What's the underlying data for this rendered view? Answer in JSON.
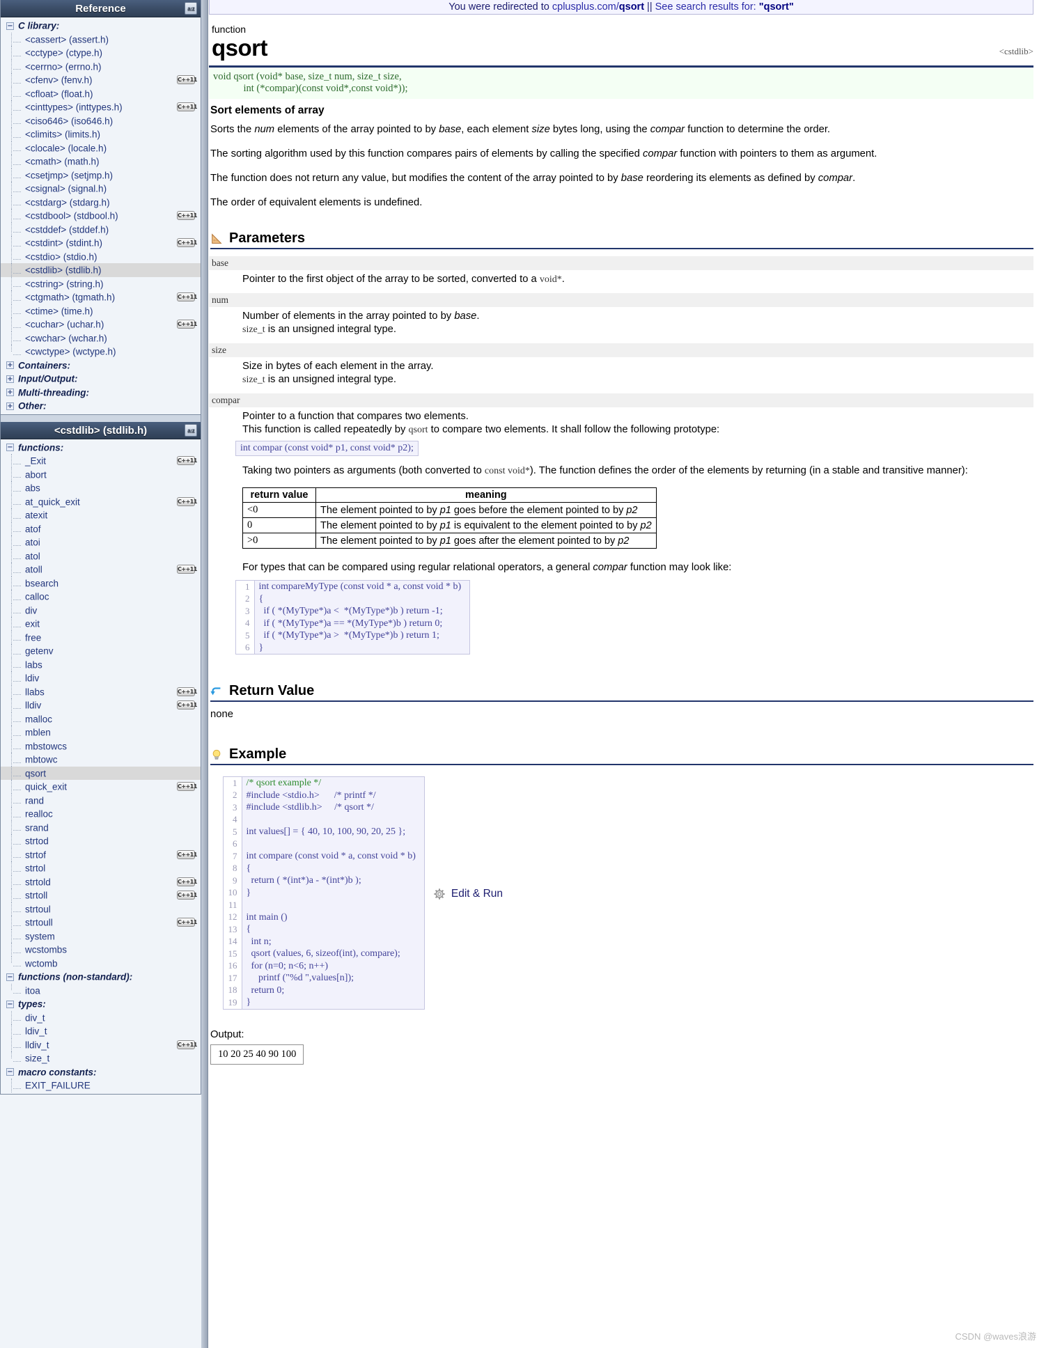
{
  "redirect": {
    "prefix": "You were redirected to ",
    "link": "cplusplus.com/",
    "link_bold": "qsort",
    "separator": " || ",
    "search_text": "See search results for: ",
    "search_term": "\"qsort\""
  },
  "sidebar": {
    "reference_panel": {
      "title": "Reference",
      "az_icon": "a-z-sort-icon",
      "items": [
        {
          "label": "C library:",
          "type": "group",
          "toggle": "−"
        },
        {
          "label": "<cassert> (assert.h)",
          "type": "leaf"
        },
        {
          "label": "<cctype> (ctype.h)",
          "type": "leaf"
        },
        {
          "label": "<cerrno> (errno.h)",
          "type": "leaf"
        },
        {
          "label": "<cfenv> (fenv.h)",
          "type": "leaf",
          "flag": "C++11"
        },
        {
          "label": "<cfloat> (float.h)",
          "type": "leaf"
        },
        {
          "label": "<cinttypes> (inttypes.h)",
          "type": "leaf",
          "flag": "C++11"
        },
        {
          "label": "<ciso646> (iso646.h)",
          "type": "leaf"
        },
        {
          "label": "<climits> (limits.h)",
          "type": "leaf"
        },
        {
          "label": "<clocale> (locale.h)",
          "type": "leaf"
        },
        {
          "label": "<cmath> (math.h)",
          "type": "leaf"
        },
        {
          "label": "<csetjmp> (setjmp.h)",
          "type": "leaf"
        },
        {
          "label": "<csignal> (signal.h)",
          "type": "leaf"
        },
        {
          "label": "<cstdarg> (stdarg.h)",
          "type": "leaf"
        },
        {
          "label": "<cstdbool> (stdbool.h)",
          "type": "leaf",
          "flag": "C++11"
        },
        {
          "label": "<cstddef> (stddef.h)",
          "type": "leaf"
        },
        {
          "label": "<cstdint> (stdint.h)",
          "type": "leaf",
          "flag": "C++11"
        },
        {
          "label": "<cstdio> (stdio.h)",
          "type": "leaf"
        },
        {
          "label": "<cstdlib> (stdlib.h)",
          "type": "leaf",
          "selected": true
        },
        {
          "label": "<cstring> (string.h)",
          "type": "leaf"
        },
        {
          "label": "<ctgmath> (tgmath.h)",
          "type": "leaf",
          "flag": "C++11"
        },
        {
          "label": "<ctime> (time.h)",
          "type": "leaf"
        },
        {
          "label": "<cuchar> (uchar.h)",
          "type": "leaf",
          "flag": "C++11"
        },
        {
          "label": "<cwchar> (wchar.h)",
          "type": "leaf"
        },
        {
          "label": "<cwctype> (wctype.h)",
          "type": "leaf",
          "last": true
        },
        {
          "label": "Containers:",
          "type": "group",
          "toggle": "+"
        },
        {
          "label": "Input/Output:",
          "type": "group",
          "toggle": "+"
        },
        {
          "label": "Multi-threading:",
          "type": "group",
          "toggle": "+"
        },
        {
          "label": "Other:",
          "type": "group",
          "toggle": "+"
        }
      ]
    },
    "cstdlib_panel": {
      "title": "<cstdlib> (stdlib.h)",
      "az_icon": "a-z-sort-icon",
      "items": [
        {
          "label": "functions:",
          "type": "group",
          "toggle": "−"
        },
        {
          "label": "_Exit",
          "type": "leaf",
          "flag": "C++11"
        },
        {
          "label": "abort",
          "type": "leaf"
        },
        {
          "label": "abs",
          "type": "leaf"
        },
        {
          "label": "at_quick_exit",
          "type": "leaf",
          "flag": "C++11"
        },
        {
          "label": "atexit",
          "type": "leaf"
        },
        {
          "label": "atof",
          "type": "leaf"
        },
        {
          "label": "atoi",
          "type": "leaf"
        },
        {
          "label": "atol",
          "type": "leaf"
        },
        {
          "label": "atoll",
          "type": "leaf",
          "flag": "C++11"
        },
        {
          "label": "bsearch",
          "type": "leaf"
        },
        {
          "label": "calloc",
          "type": "leaf"
        },
        {
          "label": "div",
          "type": "leaf"
        },
        {
          "label": "exit",
          "type": "leaf"
        },
        {
          "label": "free",
          "type": "leaf"
        },
        {
          "label": "getenv",
          "type": "leaf"
        },
        {
          "label": "labs",
          "type": "leaf"
        },
        {
          "label": "ldiv",
          "type": "leaf"
        },
        {
          "label": "llabs",
          "type": "leaf",
          "flag": "C++11"
        },
        {
          "label": "lldiv",
          "type": "leaf",
          "flag": "C++11"
        },
        {
          "label": "malloc",
          "type": "leaf"
        },
        {
          "label": "mblen",
          "type": "leaf"
        },
        {
          "label": "mbstowcs",
          "type": "leaf"
        },
        {
          "label": "mbtowc",
          "type": "leaf"
        },
        {
          "label": "qsort",
          "type": "leaf",
          "selected": true
        },
        {
          "label": "quick_exit",
          "type": "leaf",
          "flag": "C++11"
        },
        {
          "label": "rand",
          "type": "leaf"
        },
        {
          "label": "realloc",
          "type": "leaf"
        },
        {
          "label": "srand",
          "type": "leaf"
        },
        {
          "label": "strtod",
          "type": "leaf"
        },
        {
          "label": "strtof",
          "type": "leaf",
          "flag": "C++11"
        },
        {
          "label": "strtol",
          "type": "leaf"
        },
        {
          "label": "strtold",
          "type": "leaf",
          "flag": "C++11"
        },
        {
          "label": "strtoll",
          "type": "leaf",
          "flag": "C++11"
        },
        {
          "label": "strtoul",
          "type": "leaf"
        },
        {
          "label": "strtoull",
          "type": "leaf",
          "flag": "C++11"
        },
        {
          "label": "system",
          "type": "leaf"
        },
        {
          "label": "wcstombs",
          "type": "leaf"
        },
        {
          "label": "wctomb",
          "type": "leaf",
          "last": true
        },
        {
          "label": "functions (non-standard):",
          "type": "group",
          "toggle": "−"
        },
        {
          "label": "itoa",
          "type": "leaf",
          "last": true
        },
        {
          "label": "types:",
          "type": "group",
          "toggle": "−"
        },
        {
          "label": "div_t",
          "type": "leaf"
        },
        {
          "label": "ldiv_t",
          "type": "leaf"
        },
        {
          "label": "lldiv_t",
          "type": "leaf",
          "flag": "C++11"
        },
        {
          "label": "size_t",
          "type": "leaf",
          "last": true
        },
        {
          "label": "macro constants:",
          "type": "group",
          "toggle": "−"
        },
        {
          "label": "EXIT_FAILURE",
          "type": "leaf"
        }
      ]
    }
  },
  "article": {
    "kind": "function",
    "name": "qsort",
    "header_tag": "<cstdlib>",
    "prototype_line1": "void qsort (void* base, size_t num, size_t size,",
    "prototype_line2": "            int (*compar)(const void*,const void*));",
    "subtitle": "Sort elements of array",
    "paragraphs": [
      "Sorts the num elements of the array pointed to by base, each element size bytes long, using the compar function to determine the order.",
      "The sorting algorithm used by this function compares pairs of elements by calling the specified compar function with pointers to them as argument.",
      "The function does not return any value, but modifies the content of the array pointed to by base reordering its elements as defined by compar.",
      "The order of equivalent elements is undefined."
    ],
    "sections": {
      "parameters": {
        "title": "Parameters",
        "icon": "ruler-icon"
      },
      "return_value": {
        "title": "Return Value",
        "icon": "return-arrow-icon",
        "content": "none"
      },
      "example": {
        "title": "Example",
        "icon": "lightbulb-icon"
      }
    },
    "parameters": [
      {
        "name": "base",
        "lines": [
          "Pointer to the first object of the array to be sorted, converted to a void*."
        ]
      },
      {
        "name": "num",
        "lines": [
          "Number of elements in the array pointed to by base.",
          "size_t is an unsigned integral type."
        ]
      },
      {
        "name": "size",
        "lines": [
          "Size in bytes of each element in the array.",
          "size_t is an unsigned integral type."
        ]
      },
      {
        "name": "compar",
        "lines": [
          "Pointer to a function that compares two elements.",
          "This function is called repeatedly by qsort to compare two elements. It shall follow the following prototype:"
        ],
        "code": "int compar (const void* p1, const void* p2);",
        "after_lines": [
          "Taking two pointers as arguments (both converted to const void*). The function defines the order of the elements by returning (in a stable and transitive manner):"
        ],
        "table": {
          "headers": [
            "return value",
            "meaning"
          ],
          "rows": [
            [
              "<0",
              "The element pointed to by p1 goes before the element pointed to by p2"
            ],
            [
              "0",
              "The element pointed to by p1 is equivalent to the element pointed to by p2"
            ],
            [
              ">0",
              "The element pointed to by p1 goes after the element pointed to by p2"
            ]
          ]
        },
        "closing_line": "For types that can be compared using regular relational operators, a general compar function may look like:",
        "snippet": [
          {
            "n": "1",
            "t": "int compareMyType (const void * a, const void * b)"
          },
          {
            "n": "2",
            "t": "{"
          },
          {
            "n": "3",
            "t": "  if ( *(MyType*)a <  *(MyType*)b ) return -1;"
          },
          {
            "n": "4",
            "t": "  if ( *(MyType*)a == *(MyType*)b ) return 0;"
          },
          {
            "n": "5",
            "t": "  if ( *(MyType*)a >  *(MyType*)b ) return 1;"
          },
          {
            "n": "6",
            "t": "}"
          }
        ]
      }
    ],
    "example_code": [
      {
        "n": "1",
        "t": "/* qsort example */",
        "cls": "cmt"
      },
      {
        "n": "2",
        "t": "#include <stdio.h>      /* printf */"
      },
      {
        "n": "3",
        "t": "#include <stdlib.h>     /* qsort */"
      },
      {
        "n": "4",
        "t": ""
      },
      {
        "n": "5",
        "t": "int values[] = { 40, 10, 100, 90, 20, 25 };"
      },
      {
        "n": "6",
        "t": ""
      },
      {
        "n": "7",
        "t": "int compare (const void * a, const void * b)"
      },
      {
        "n": "8",
        "t": "{"
      },
      {
        "n": "9",
        "t": "  return ( *(int*)a - *(int*)b );"
      },
      {
        "n": "10",
        "t": "}"
      },
      {
        "n": "11",
        "t": ""
      },
      {
        "n": "12",
        "t": "int main ()"
      },
      {
        "n": "13",
        "t": "{"
      },
      {
        "n": "14",
        "t": "  int n;"
      },
      {
        "n": "15",
        "t": "  qsort (values, 6, sizeof(int), compare);"
      },
      {
        "n": "16",
        "t": "  for (n=0; n<6; n++)"
      },
      {
        "n": "17",
        "t": "     printf (\"%d \",values[n]);"
      },
      {
        "n": "18",
        "t": "  return 0;"
      },
      {
        "n": "19",
        "t": "}"
      }
    ],
    "edit_run": {
      "label": "Edit & Run",
      "icon": "gear-icon"
    },
    "output": {
      "label": "Output:",
      "value": "10 20 25 40 90 100"
    }
  },
  "watermark": "CSDN @waves浪游",
  "colors": {
    "panel_header_dark": "#3b4d67",
    "link_blue": "#22367c",
    "rule_navy": "#22356b",
    "code_purple": "#44449a",
    "proto_green": "#2e6b2e"
  }
}
